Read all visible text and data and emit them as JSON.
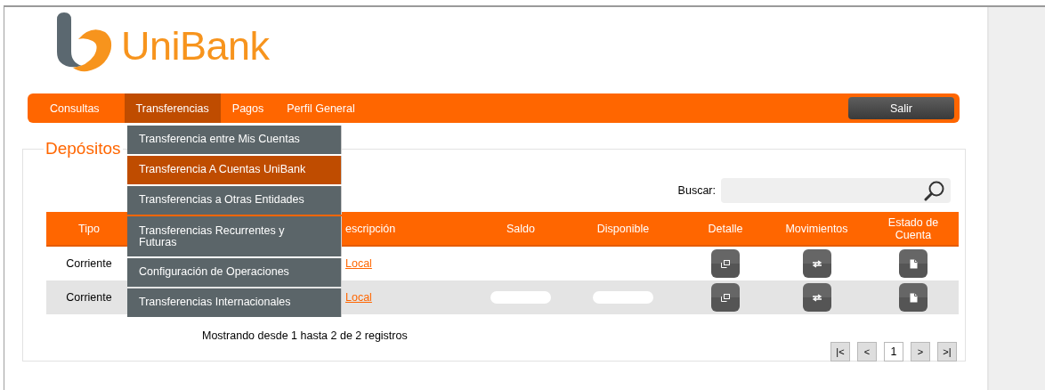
{
  "logo": {
    "name": "UniBank"
  },
  "nav": {
    "tabs": [
      {
        "label": "Consultas",
        "selected": false
      },
      {
        "label": "Transferencias",
        "selected": true
      },
      {
        "label": "Pagos",
        "selected": false
      },
      {
        "label": "Perfil General",
        "selected": false
      }
    ],
    "logout": "Salir"
  },
  "dropdown": {
    "items": [
      {
        "label": "Transferencia entre Mis Cuentas",
        "selected": false
      },
      {
        "label": "Transferencia A Cuentas UniBank",
        "selected": true
      },
      {
        "label": "Transferencias a Otras Entidades",
        "selected": false
      },
      {
        "label": "Transferencias Recurrentes y Futuras",
        "selected": false
      },
      {
        "label": "Configuración de Operaciones",
        "selected": false
      },
      {
        "label": "Transferencias Internacionales",
        "selected": false
      }
    ]
  },
  "section": {
    "title": "Depósitos",
    "search": {
      "label": "Buscar:"
    },
    "table": {
      "columns": [
        "Tipo",
        "escripción",
        "Saldo",
        "Disponible",
        "Detalle",
        "Movimientos",
        "Estado de Cuenta"
      ],
      "rows": [
        {
          "tipo": "Corriente",
          "descripcion": "Local",
          "redacted": false
        },
        {
          "tipo": "Corriente",
          "descripcion": "Local",
          "redacted": true
        }
      ]
    },
    "summary": "Mostrando desde 1 hasta 2 de 2 registros",
    "pagination": [
      {
        "label": "|<",
        "kind": "nav",
        "selected": false
      },
      {
        "label": "<",
        "kind": "nav",
        "selected": false
      },
      {
        "label": "1",
        "kind": "page",
        "selected": true
      },
      {
        "label": ">",
        "kind": "nav",
        "selected": false
      },
      {
        "label": ">|",
        "kind": "nav",
        "selected": false
      }
    ]
  }
}
